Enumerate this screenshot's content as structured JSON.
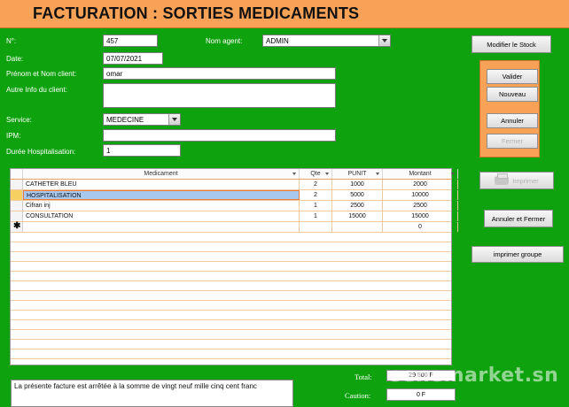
{
  "header": {
    "title": "FACTURATION : SORTIES MEDICAMENTS"
  },
  "form": {
    "no_label": "N°:",
    "no_value": "457",
    "date_label": "Date:",
    "date_value": "07/07/2021",
    "agent_label": "Nom agent:",
    "agent_value": "ADMIN",
    "client_label": "Prénom et Nom client:",
    "client_value": "omar",
    "info_label": "Autre Info du client:",
    "info_value": "",
    "service_label": "Service:",
    "service_value": "MEDECINE",
    "ipm_label": "IPM:",
    "ipm_value": "",
    "duree_label": "Durée Hospitalisation:",
    "duree_value": "1"
  },
  "buttons": {
    "modifier_stock": "Modifier le Stock",
    "valider": "Valider",
    "nouveau": "Nouveau",
    "annuler": "Annuler",
    "fermer": "Fermer",
    "imprimer": "Imprimer",
    "annuler_fermer": "Annuler et Fermer",
    "imprimer_groupe": "imprimer groupe"
  },
  "grid": {
    "columns": [
      "Medicament",
      "Qte",
      "PUNIT",
      "Montant"
    ],
    "rows": [
      {
        "medicament": "CATHETER BLEU",
        "qte": "2",
        "punit": "1000",
        "montant": "2000"
      },
      {
        "medicament": "HOSPITALISATION",
        "qte": "2",
        "punit": "5000",
        "montant": "10000"
      },
      {
        "medicament": "Cifran inj",
        "qte": "1",
        "punit": "2500",
        "montant": "2500"
      },
      {
        "medicament": "CONSULTATION",
        "qte": "1",
        "punit": "15000",
        "montant": "15000"
      }
    ],
    "new_row": {
      "marker": "✱",
      "montant": "0"
    }
  },
  "footer": {
    "amount_text": "La présente facture est arrêtée à la somme de vingt neuf mille cinq cent franc",
    "total_label": "Total:",
    "total_value": "29 500 F",
    "caution_label": "Caution:",
    "caution_value": "0 F",
    "watermark": "senemarket.sn"
  },
  "colors": {
    "background": "#0ea20e",
    "accent": "#f7a256",
    "selection": "#a8c8ee"
  }
}
